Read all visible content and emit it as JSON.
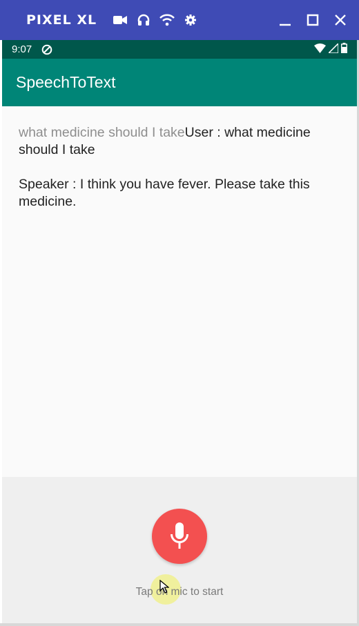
{
  "emulator": {
    "title": "PIXEL XL",
    "tools": [
      "video-camera-icon",
      "headphones-icon",
      "wifi-icon",
      "settings-gear-icon"
    ],
    "controls": [
      "minimize-icon",
      "maximize-icon",
      "close-icon"
    ]
  },
  "status_bar": {
    "time": "9:07",
    "icons": [
      "notification-icon",
      "wifi-icon",
      "signal-icon",
      "battery-icon"
    ]
  },
  "app_bar": {
    "title": "SpeechToText"
  },
  "conversation": {
    "partial_result": "what medicine should I take",
    "user_line": "User : what medicine should I take",
    "speaker_line": "Speaker : I think you have fever. Please take this medicine."
  },
  "speech_sheet": {
    "hint": "Tap on mic to start",
    "mic_color": "#f35050"
  },
  "colors": {
    "emulator_bar": "#3f4bb5",
    "status_bar": "#00574b",
    "app_bar": "#008577"
  }
}
